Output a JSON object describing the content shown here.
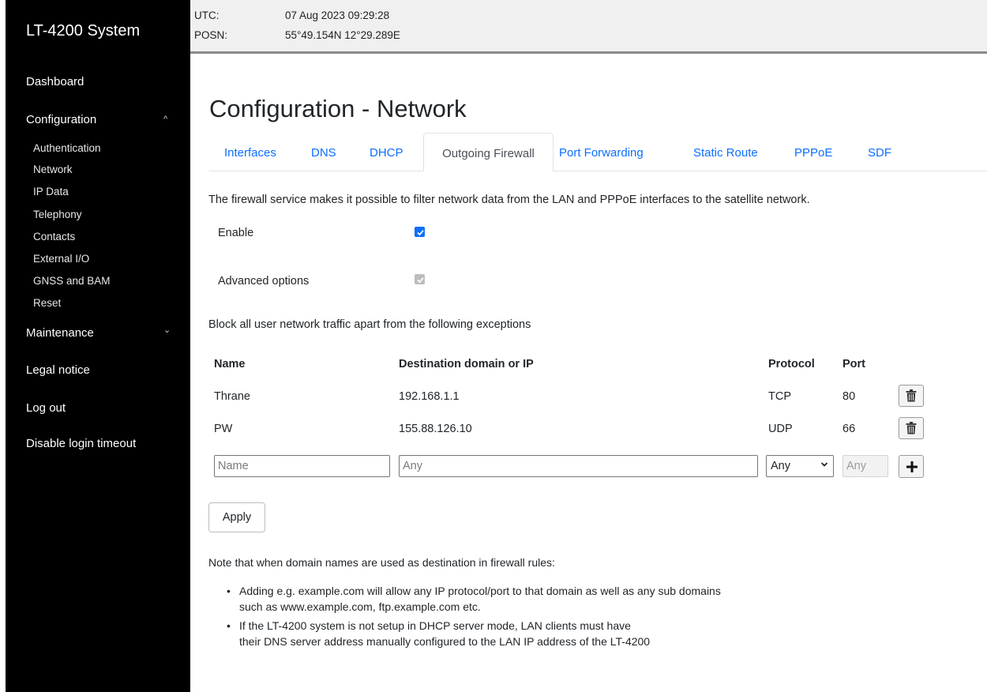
{
  "app": {
    "brand": "LT-4200 System"
  },
  "sidebar": {
    "dashboard": "Dashboard",
    "configuration": "Configuration",
    "configuration_chevron": "^",
    "sub_items": [
      "Authentication",
      "Network",
      "IP Data",
      "Telephony",
      "Contacts",
      "External I/O",
      "GNSS and BAM",
      "Reset"
    ],
    "maintenance": "Maintenance",
    "maintenance_chevron": "⌄",
    "legal_notice": "Legal notice",
    "log_out": "Log out",
    "disable_login_timeout": "Disable login timeout"
  },
  "topbar": {
    "utc_label": "UTC:",
    "utc_value": "07 Aug 2023 09:29:28",
    "posn_label": "POSN:",
    "posn_value": "55°49.154N 12°29.289E"
  },
  "page": {
    "title": "Configuration - Network",
    "tabs": [
      "Interfaces",
      "DNS",
      "DHCP",
      "Outgoing Firewall",
      "Port Forwarding",
      "Static Route",
      "PPPoE",
      "SDF"
    ],
    "active_tab": "Outgoing Firewall",
    "description": "The firewall service makes it possible to filter network data from the LAN and PPPoE interfaces to the satellite network.",
    "enable_label": "Enable",
    "enable_checked": true,
    "advanced_label": "Advanced options",
    "advanced_checked": true,
    "block_text": "Block all user network traffic apart from the following exceptions"
  },
  "rules_table": {
    "headers": {
      "name": "Name",
      "destination": "Destination domain or IP",
      "protocol": "Protocol",
      "port": "Port"
    },
    "rows": [
      {
        "name": "Thrane",
        "destination": "192.168.1.1",
        "protocol": "TCP",
        "port": "80"
      },
      {
        "name": "PW",
        "destination": "155.88.126.10",
        "protocol": "UDP",
        "port": "66"
      }
    ],
    "new_rule": {
      "name_placeholder": "Name",
      "destination_placeholder": "Any",
      "protocol_value": "Any",
      "port_placeholder": "Any"
    }
  },
  "apply_label": "Apply",
  "note": {
    "intro": "Note that when domain names are used as destination in firewall rules:",
    "bullet1_line1": "Adding e.g. example.com will allow any IP protocol/port to that domain as well as any sub domains",
    "bullet1_line2": "such as www.example.com, ftp.example.com etc.",
    "bullet2_line1": "If the LT-4200 system is not setup in DHCP server mode, LAN clients must have",
    "bullet2_line2": "their DNS server address manually configured to the LAN IP address of the LT-4200"
  },
  "icons": {
    "delete": "trash-icon",
    "add": "plus-icon",
    "check": "check-icon",
    "dropdown": "chevron-down-icon"
  },
  "colors": {
    "sidebar_bg": "#000000",
    "link": "#0d6efd",
    "checkbox": "#0d6efd",
    "topbar_bg": "#f0f0f0"
  }
}
